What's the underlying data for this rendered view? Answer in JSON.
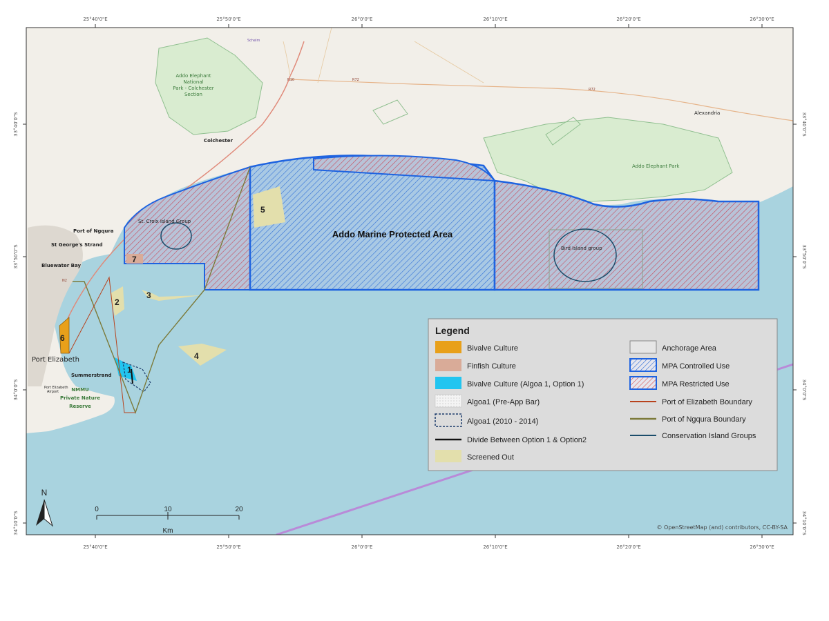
{
  "map": {
    "top_ticks": [
      "25°40'0\"E",
      "25°50'0\"E",
      "26°0'0\"E",
      "26°10'0\"E",
      "26°20'0\"E",
      "26°30'0\"E"
    ],
    "bottom_ticks": [
      "25°40'0\"E",
      "25°50'0\"E",
      "26°0'0\"E",
      "26°10'0\"E",
      "26°20'0\"E",
      "26°30'0\"E"
    ],
    "left_ticks": [
      "33°40'0\"S",
      "33°50'0\"S",
      "34°0'0\"S",
      "34°10'0\"S"
    ],
    "right_ticks": [
      "33°40'0\"S",
      "33°50'0\"S",
      "34°0'0\"S",
      "34°10'0\"S"
    ],
    "colors": {
      "sea": "#a9d3df",
      "land": "#f2efe9",
      "park": "#d9ecd0",
      "mpa_controlled": "#2f6fd8",
      "mpa_restricted": "#d94a4a",
      "mpa_border": "#1e63e0",
      "bivalve": "#e8a01a",
      "finfish": "#d9ab98",
      "bivalve_algoa": "#22c5f0",
      "screened_out": "#e3dfac",
      "port_elizabeth_boundary": "#b8421c",
      "port_ngqura_boundary": "#7c7a3a",
      "conservation_island": "#1b4d6b"
    }
  },
  "places": {
    "addo_park_colchester": [
      "Addo Elephant",
      "National",
      "Park - Colchester",
      "Section"
    ],
    "colchester": "Colchester",
    "alexandria": "Alexandria",
    "addo_elephant_park": "Addo Elephant Park",
    "port_of_ngqura": "Port of Ngqura",
    "st_georges_strand": "St George's Strand",
    "bluewater_bay": "Bluewater Bay",
    "port_elizabeth": "Port Elizabeth",
    "summerstrand": "Summerstrand",
    "port_elizabeth_airport": [
      "Port Elizabeth",
      "Airport"
    ],
    "nmmu_reserve": [
      "NMMU",
      "Private Nature",
      "Reserve"
    ],
    "st_croix_island_group": "St. Croix Island Group",
    "bird_island_group": "Bird Island group",
    "addo_mpa": "Addo Marine Protected Area",
    "roads": [
      "N10",
      "R72",
      "R72",
      "N2"
    ],
    "schelm": "Schelm"
  },
  "sites": [
    "1",
    "2",
    "3",
    "4",
    "5",
    "6",
    "7"
  ],
  "legend": {
    "title": "Legend",
    "left_items": [
      "Bivalve Culture",
      "Finfish Culture",
      "Bivalve Culture (Algoa 1, Option 1)",
      "Algoa1 (Pre-App Bar)",
      "Algoa1 (2010 - 2014)",
      "Divide Between Option 1 & Option2",
      "Screened Out"
    ],
    "right_items": [
      "Anchorage Area",
      "MPA Controlled Use",
      "MPA Restricted Use",
      "Port of Elizabeth Boundary",
      "Port of Ngqura Boundary",
      "Conservation Island Groups"
    ]
  },
  "north_arrow": "N",
  "scale_bar": {
    "ticks": [
      "0",
      "10",
      "20"
    ],
    "unit": "Km"
  },
  "credit": "© OpenStreetMap (and) contributors, CC-BY-SA"
}
